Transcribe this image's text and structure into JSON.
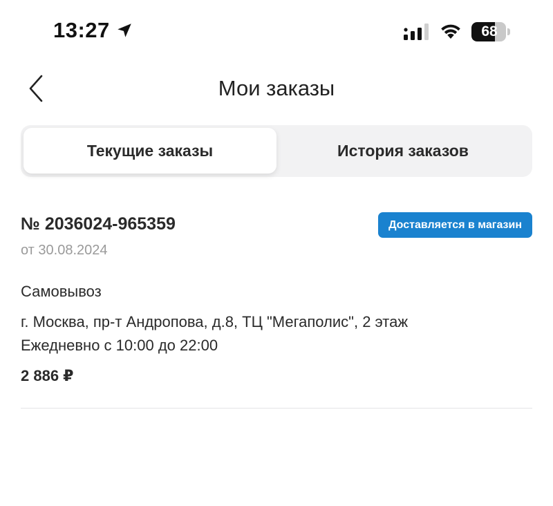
{
  "status_bar": {
    "time": "13:27",
    "battery_percent": "68",
    "battery_level": 0.68
  },
  "header": {
    "title": "Мои заказы"
  },
  "tabs": [
    {
      "label": "Текущие заказы",
      "selected": true
    },
    {
      "label": "История заказов",
      "selected": false
    }
  ],
  "orders": [
    {
      "number": "№ 2036024-965359",
      "date": "от 30.08.2024",
      "status": "Доставляется в магазин",
      "status_color": "#1a82cf",
      "delivery_type": "Самовывоз",
      "address": "г. Москва, пр-т Андропова, д.8, ТЦ \"Мегаполис\", 2 этаж",
      "hours": "Ежедневно с 10:00 до 22:00",
      "total": "2 886 ₽"
    }
  ],
  "icons": {
    "back": "chevron-left-icon",
    "location": "location-arrow-icon",
    "signal": "cellular-signal-icon",
    "wifi": "wifi-icon",
    "battery": "battery-icon"
  }
}
